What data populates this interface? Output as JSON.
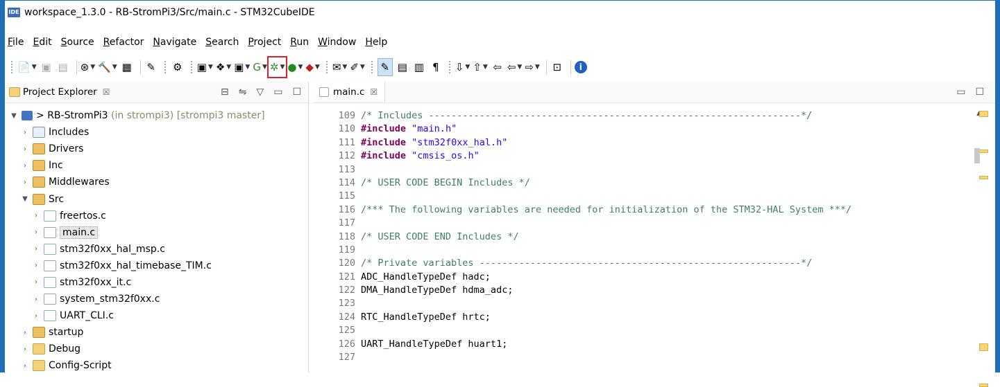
{
  "window": {
    "title": "workspace_1.3.0 - RB-StromPi3/Src/main.c - STM32CubeIDE",
    "app_icon_text": "IDE"
  },
  "menu": [
    "File",
    "Edit",
    "Source",
    "Refactor",
    "Navigate",
    "Search",
    "Project",
    "Run",
    "Window",
    "Help"
  ],
  "explorer": {
    "title": "Project Explorer",
    "close": "☒",
    "project": {
      "name": "RB-StromPi3",
      "decoration": "(in strompi3) [strompi3 master]",
      "prefix": ">"
    },
    "items": [
      {
        "label": "Includes",
        "indent": 1,
        "expanded": false,
        "icon": "includes-icon"
      },
      {
        "label": "Drivers",
        "indent": 1,
        "expanded": false,
        "icon": "source-folder-icon"
      },
      {
        "label": "Inc",
        "indent": 1,
        "expanded": false,
        "icon": "source-folder-icon"
      },
      {
        "label": "Middlewares",
        "indent": 1,
        "expanded": false,
        "icon": "source-folder-icon"
      },
      {
        "label": "Src",
        "indent": 1,
        "expanded": true,
        "icon": "source-folder-icon"
      },
      {
        "label": "freertos.c",
        "indent": 2,
        "expanded": false,
        "icon": "c-file-icon"
      },
      {
        "label": "main.c",
        "indent": 2,
        "expanded": false,
        "icon": "c-file-icon",
        "selected": true
      },
      {
        "label": "stm32f0xx_hal_msp.c",
        "indent": 2,
        "expanded": false,
        "icon": "c-file-icon"
      },
      {
        "label": "stm32f0xx_hal_timebase_TIM.c",
        "indent": 2,
        "expanded": false,
        "icon": "c-file-icon"
      },
      {
        "label": "stm32f0xx_it.c",
        "indent": 2,
        "expanded": false,
        "icon": "c-file-icon"
      },
      {
        "label": "system_stm32f0xx.c",
        "indent": 2,
        "expanded": false,
        "icon": "c-file-icon"
      },
      {
        "label": "UART_CLI.c",
        "indent": 2,
        "expanded": false,
        "icon": "c-file-icon"
      },
      {
        "label": "startup",
        "indent": 1,
        "expanded": false,
        "icon": "source-folder-icon"
      },
      {
        "label": "Debug",
        "indent": 1,
        "expanded": false,
        "icon": "folder-icon"
      },
      {
        "label": "Config-Script",
        "indent": 1,
        "expanded": false,
        "icon": "folder-icon"
      }
    ]
  },
  "editor": {
    "tab_label": "main.c",
    "tab_close": "☒",
    "lines": [
      {
        "n": "109",
        "parts": [
          [
            "c-comment",
            "/* Includes ------------------------------------------------------------------*/"
          ]
        ]
      },
      {
        "n": "110",
        "parts": [
          [
            "c-kw",
            "#include"
          ],
          [
            "",
            " "
          ],
          [
            "c-str",
            "\"main.h\""
          ]
        ]
      },
      {
        "n": "111",
        "parts": [
          [
            "c-kw",
            "#include"
          ],
          [
            "",
            " "
          ],
          [
            "c-str",
            "\"stm32f0xx_hal.h\""
          ]
        ]
      },
      {
        "n": "112",
        "parts": [
          [
            "c-kw",
            "#include"
          ],
          [
            "",
            " "
          ],
          [
            "c-str",
            "\"cmsis_os.h\""
          ]
        ]
      },
      {
        "n": "113",
        "parts": []
      },
      {
        "n": "114",
        "parts": [
          [
            "c-comment",
            "/* USER CODE BEGIN Includes */"
          ]
        ]
      },
      {
        "n": "115",
        "parts": []
      },
      {
        "n": "116",
        "parts": [
          [
            "c-comment",
            "/*** The following variables are needed for initialization of the STM32-HAL System ***/"
          ]
        ]
      },
      {
        "n": "117",
        "parts": []
      },
      {
        "n": "118",
        "parts": [
          [
            "c-comment",
            "/* USER CODE END Includes */"
          ]
        ]
      },
      {
        "n": "119",
        "parts": []
      },
      {
        "n": "120",
        "parts": [
          [
            "c-comment",
            "/* Private variables ---------------------------------------------------------*/"
          ]
        ]
      },
      {
        "n": "121",
        "parts": [
          [
            "",
            "ADC_HandleTypeDef hadc;"
          ]
        ]
      },
      {
        "n": "122",
        "parts": [
          [
            "",
            "DMA_HandleTypeDef hdma_adc;"
          ]
        ]
      },
      {
        "n": "123",
        "parts": []
      },
      {
        "n": "124",
        "parts": [
          [
            "",
            "RTC_HandleTypeDef hrtc;"
          ]
        ]
      },
      {
        "n": "125",
        "parts": []
      },
      {
        "n": "126",
        "parts": [
          [
            "",
            "UART_HandleTypeDef huart1;"
          ]
        ]
      },
      {
        "n": "127",
        "parts": []
      }
    ]
  },
  "toolbar_icons": [
    "new-icon",
    "save-icon",
    "save-all-icon",
    "build-config-icon",
    "build-icon",
    "binary-icon",
    "debug-icon-small",
    "debug-icon-small-2",
    "new-c-project-icon",
    "new-source-icon",
    "new-class-icon",
    "run-last-icon",
    "debug-icon",
    "run-icon",
    "external-tools-icon",
    "open-task-icon",
    "highlight-icon",
    "toggle-mark-icon",
    "show-whitespace-icon",
    "paragraph-icon",
    "next-annotation-icon",
    "prev-annotation-icon",
    "last-edit-icon",
    "back-icon",
    "forward-icon",
    "open-perspective-icon",
    "info-icon"
  ],
  "highlight_color": "#e0202a"
}
